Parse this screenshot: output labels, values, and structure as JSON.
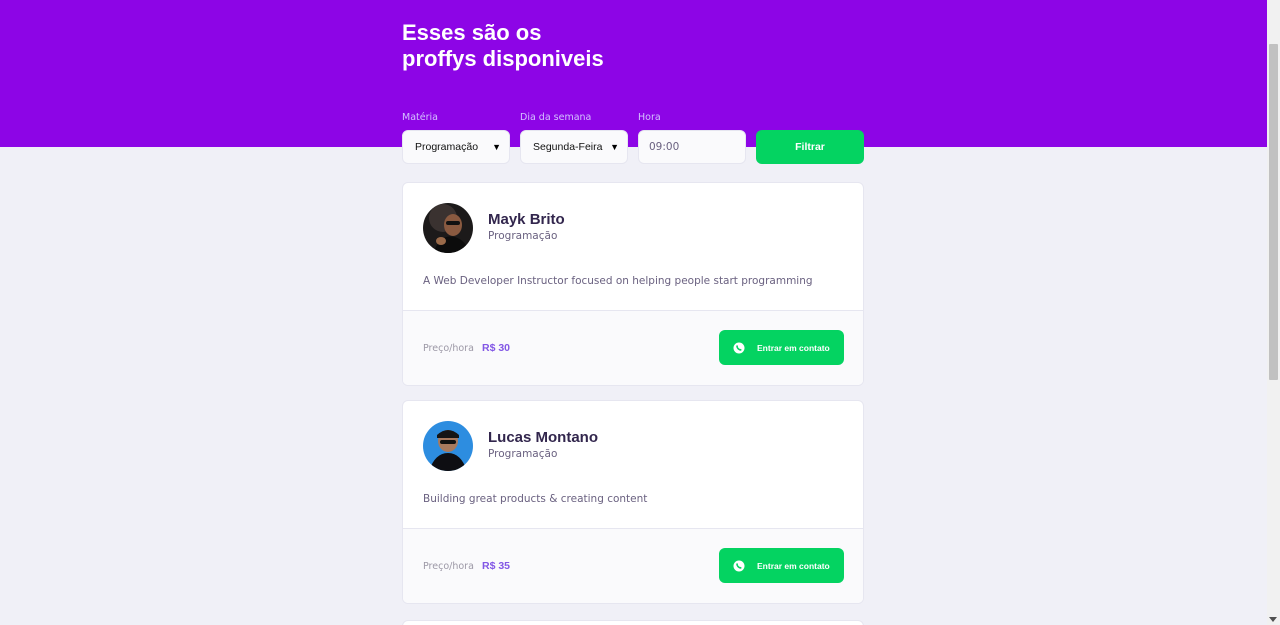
{
  "header": {
    "title_line1": "Esses são os",
    "title_line2": "proffys disponiveis"
  },
  "filters": {
    "subject_label": "Matéria",
    "subject_value": "Programação",
    "weekday_label": "Dia da semana",
    "weekday_value": "Segunda-Feira",
    "time_label": "Hora",
    "time_value": "09:00",
    "filter_button": "Filtrar"
  },
  "teachers": [
    {
      "name": "Mayk Brito",
      "subject": "Programação",
      "bio": "A Web Developer Instructor focused on helping people start programming",
      "price_label": "Preço/hora",
      "price": "R$ 30",
      "contact_button": "Entrar em contato"
    },
    {
      "name": "Lucas Montano",
      "subject": "Programação",
      "bio": "Building great products & creating content",
      "price_label": "Preço/hora",
      "price": "R$ 35",
      "contact_button": "Entrar em contato"
    }
  ],
  "colors": {
    "header_bg": "#8d05e6",
    "accent_green": "#04d361",
    "price_purple": "#8257e5",
    "text_dark": "#32264d"
  },
  "icons": {
    "whatsapp": "whatsapp-icon",
    "dropdown": "chevron-down-icon"
  }
}
